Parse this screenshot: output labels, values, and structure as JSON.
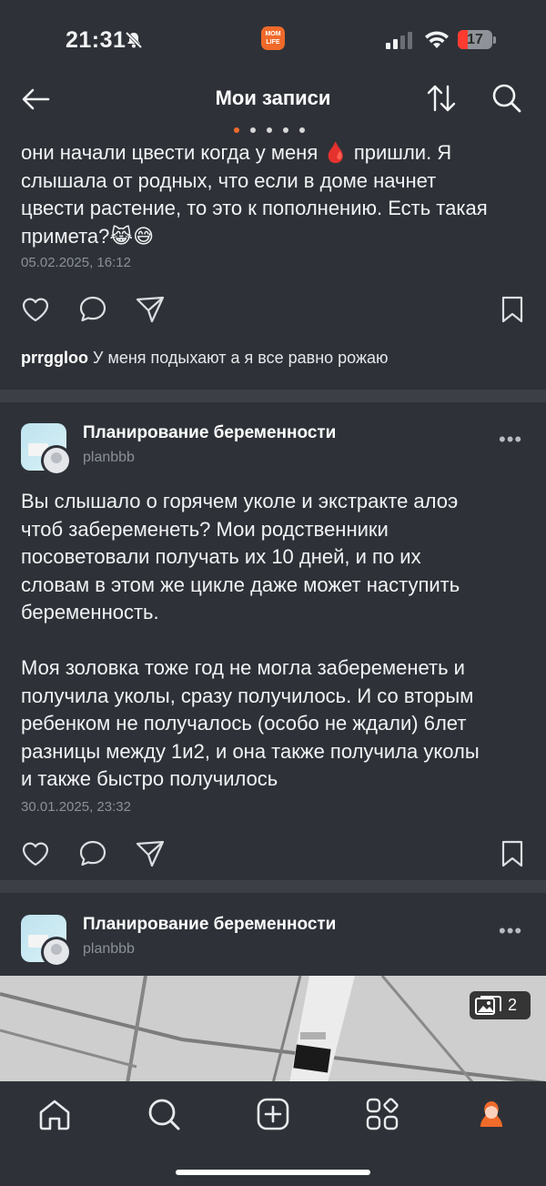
{
  "status_bar": {
    "time": "21:31",
    "app_badge": "MOM\nLIFE",
    "battery": "17"
  },
  "header": {
    "title": "Мои записи"
  },
  "posts": [
    {
      "text": "они начали цвести когда у меня 🩸 пришли. Я\nслышала от родных, что если в доме начнет\nцвести растение, то это к пополнению. Есть такая\nпримета?😹😅",
      "date": "05.02.2025, 16:12",
      "comment_author": "prrggloo",
      "comment_text": "У меня подыхают а я все равно рожаю"
    },
    {
      "channel": "Планирование беременности",
      "handle": "planbbb",
      "text": "Вы слышало о горячем уколе и экстракте алоэ\nчтоб забеременеть? Мои родственники\nпосоветовали получать их 10 дней, и по их\nсловам в этом же цикле даже может наступить\nбеременность.\n\nМоя золовка тоже год не могла забеременеть и\nполучила уколы, сразу получилось. И со вторым\nребенком не получалось (особо не ждали) 6лет\nразницы между 1и2, и она также получила уколы\nи также быстро получилось",
      "date": "30.01.2025, 23:32"
    },
    {
      "channel": "Планирование беременности",
      "handle": "planbbb",
      "media_count": "2"
    }
  ],
  "colors": {
    "background": "#2e3238",
    "divider": "#3c4046",
    "accent": "#f06a2a",
    "muted_text": "#8b9097"
  },
  "icons": [
    "back-arrow-icon",
    "sort-icon",
    "search-icon",
    "heart-icon",
    "comment-icon",
    "share-icon",
    "bookmark-icon",
    "more-icon",
    "gallery-icon",
    "home-icon",
    "plus-icon",
    "apps-icon",
    "profile-icon"
  ]
}
